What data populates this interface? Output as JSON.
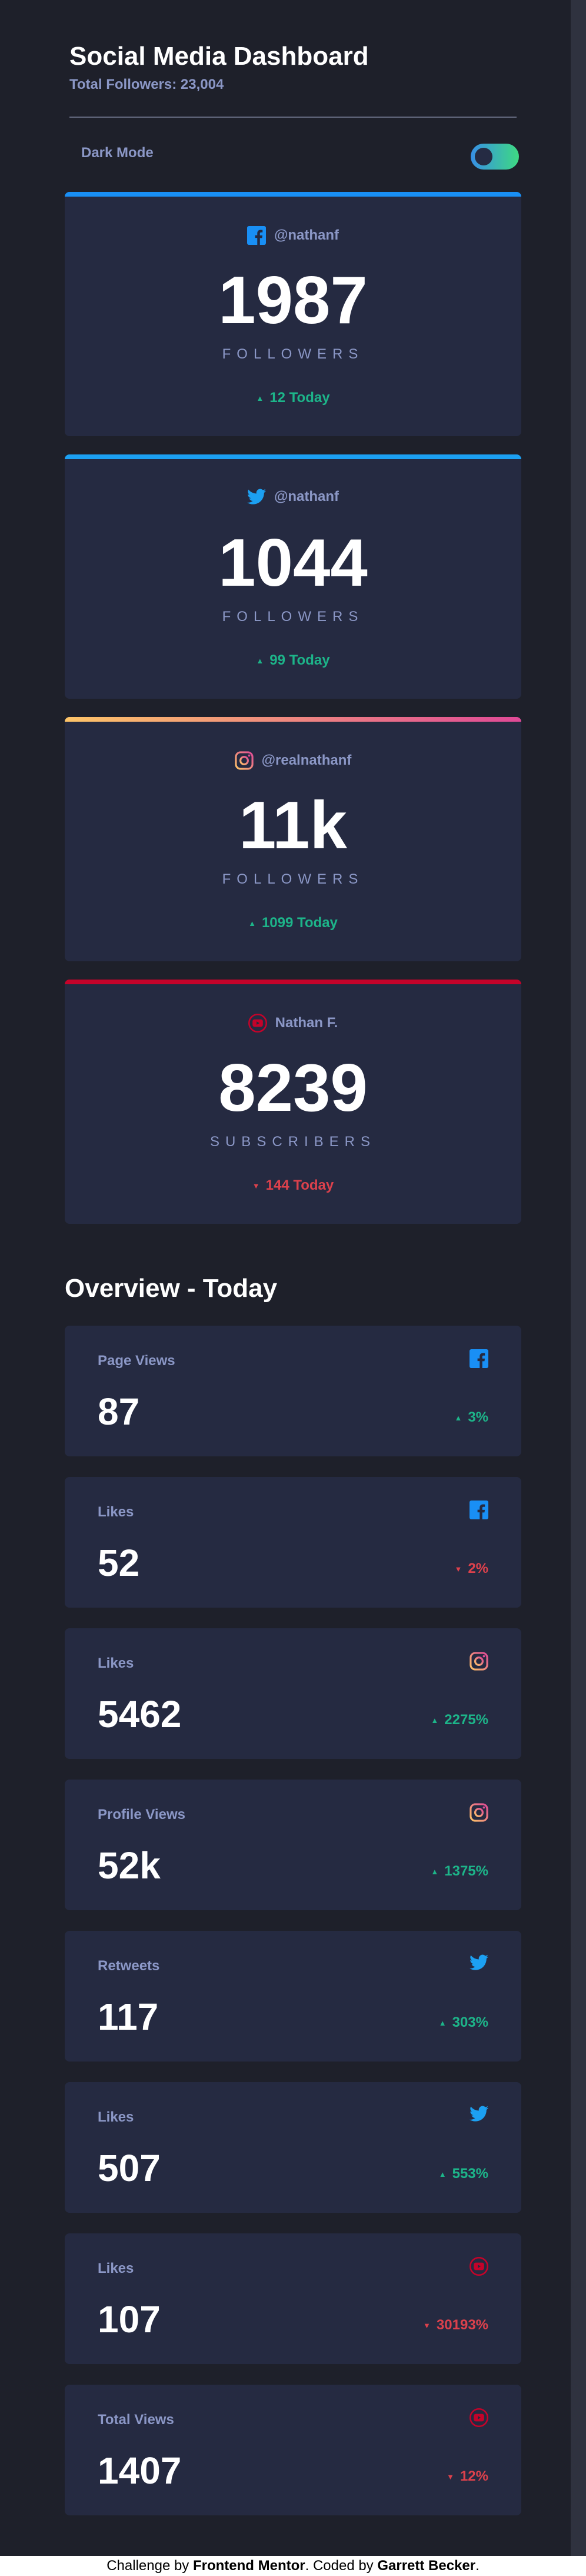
{
  "header": {
    "title": "Social Media Dashboard",
    "subtitle": "Total Followers: 23,004"
  },
  "toggle": {
    "label": "Dark Mode"
  },
  "colors": {
    "facebook": "#198ff5",
    "twitter": "#1ca0f2",
    "instagram_gradient": [
      "#fdc468",
      "#df4996"
    ],
    "youtube": "#c4032a",
    "up": "#1db489",
    "down": "#dc414c"
  },
  "cards": [
    {
      "platform": "facebook",
      "icon": "facebook-icon",
      "handle": "@nathanf",
      "count": "1987",
      "kind": "FOLLOWERS",
      "change": "12 Today",
      "direction": "up"
    },
    {
      "platform": "twitter",
      "icon": "twitter-icon",
      "handle": "@nathanf",
      "count": "1044",
      "kind": "FOLLOWERS",
      "change": "99 Today",
      "direction": "up"
    },
    {
      "platform": "instagram",
      "icon": "instagram-icon",
      "handle": "@realnathanf",
      "count": "11k",
      "kind": "FOLLOWERS",
      "change": "1099 Today",
      "direction": "up"
    },
    {
      "platform": "youtube",
      "icon": "youtube-icon",
      "handle": "Nathan F.",
      "count": "8239",
      "kind": "SUBSCRIBERS",
      "change": "144 Today",
      "direction": "down"
    }
  ],
  "overview": {
    "title": "Overview - Today",
    "items": [
      {
        "label": "Page Views",
        "platform": "facebook",
        "icon": "facebook-icon",
        "value": "87",
        "change": "3%",
        "direction": "up"
      },
      {
        "label": "Likes",
        "platform": "facebook",
        "icon": "facebook-icon",
        "value": "52",
        "change": "2%",
        "direction": "down"
      },
      {
        "label": "Likes",
        "platform": "instagram",
        "icon": "instagram-icon",
        "value": "5462",
        "change": "2275%",
        "direction": "up"
      },
      {
        "label": "Profile Views",
        "platform": "instagram",
        "icon": "instagram-icon",
        "value": "52k",
        "change": "1375%",
        "direction": "up"
      },
      {
        "label": "Retweets",
        "platform": "twitter",
        "icon": "twitter-icon",
        "value": "117",
        "change": "303%",
        "direction": "up"
      },
      {
        "label": "Likes",
        "platform": "twitter",
        "icon": "twitter-icon",
        "value": "507",
        "change": "553%",
        "direction": "up"
      },
      {
        "label": "Likes",
        "platform": "youtube",
        "icon": "youtube-icon",
        "value": "107",
        "change": "30193%",
        "direction": "down"
      },
      {
        "label": "Total Views",
        "platform": "youtube",
        "icon": "youtube-icon",
        "value": "1407",
        "change": "12%",
        "direction": "down"
      }
    ]
  },
  "footer": {
    "prefix": "Challenge by ",
    "link1": "Frontend Mentor",
    "middle": ". Coded by ",
    "link2": "Garrett Becker",
    "suffix": "."
  }
}
